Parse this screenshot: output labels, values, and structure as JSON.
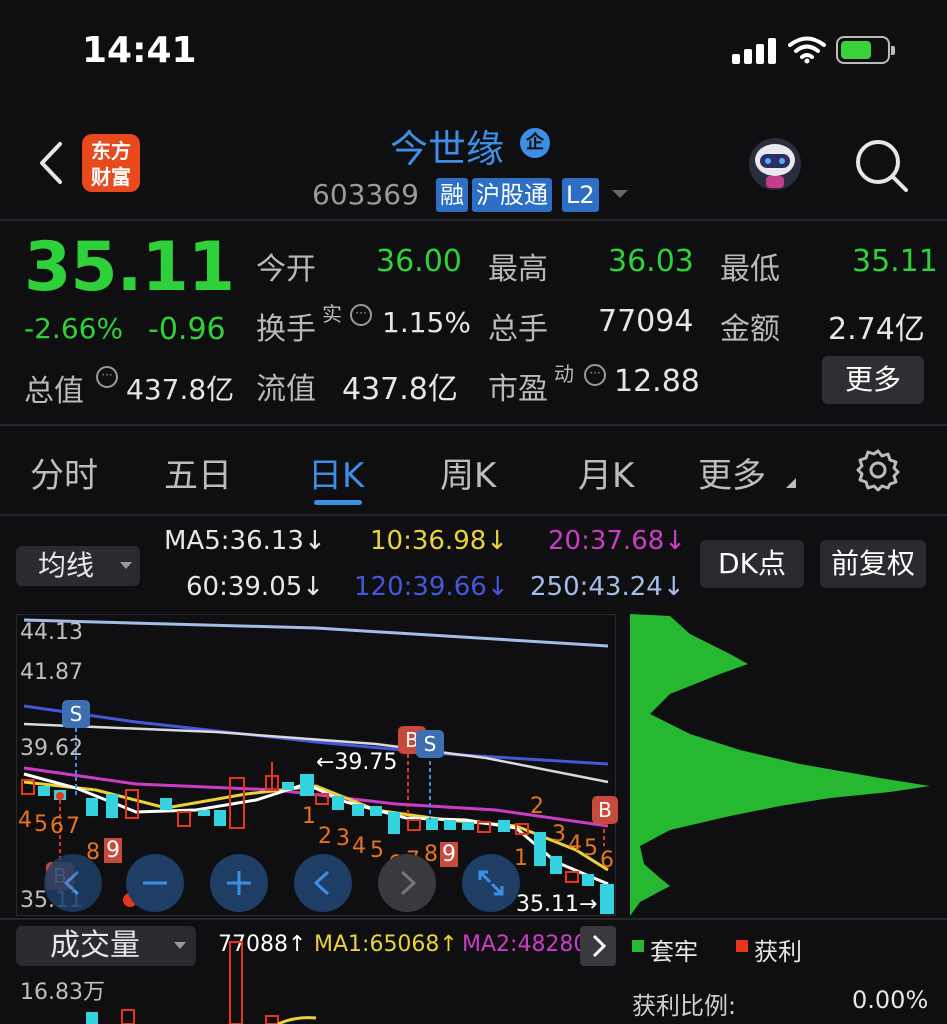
{
  "status_bar": {
    "time": "14:41"
  },
  "header": {
    "logo_line1": "东方",
    "logo_line2": "财富",
    "stock_name": "今世缘",
    "name_badge": "企",
    "stock_code": "603369",
    "tags": [
      "融",
      "沪股通",
      "L2"
    ]
  },
  "quote": {
    "price": "35.11",
    "change_pct": "-2.66%",
    "change_abs": "-0.96",
    "total_value_label": "总值",
    "total_value": "437.8亿",
    "fields": [
      {
        "label": "今开",
        "value": "36.00"
      },
      {
        "label": "最高",
        "value": "36.03"
      },
      {
        "label": "最低",
        "value": "35.11"
      },
      {
        "label": "换手",
        "sup": "实",
        "value": "1.15%"
      },
      {
        "label": "总手",
        "value": "77094"
      },
      {
        "label": "金额",
        "value": "2.74亿"
      },
      {
        "label": "流值",
        "value": "437.8亿"
      },
      {
        "label": "市盈",
        "sup": "动",
        "value": "12.88"
      }
    ],
    "more_button": "更多"
  },
  "tabs": [
    "分时",
    "五日",
    "日K",
    "周K",
    "月K",
    "更多"
  ],
  "active_tab": "日K",
  "ma_bar": {
    "selector": "均线",
    "ma5": "MA5:36.13↓",
    "ma10": "10:36.98↓",
    "ma20": "20:37.68↓",
    "ma60": "60:39.05↓",
    "ma120": "120:39.66↓",
    "ma250": "250:43.24↓",
    "dk_button": "DK点",
    "fq_button": "前复权"
  },
  "chart": {
    "y_labels": [
      "44.13",
      "41.87",
      "39.62",
      "35.11"
    ],
    "high_annotation": "←39.75",
    "low_annotation": "35.11→",
    "markers": [
      "S",
      "B",
      "S",
      "B",
      "B"
    ],
    "row1_numbers": [
      "4",
      "5",
      "6",
      "7"
    ],
    "row2_numbers": [
      "8",
      "9"
    ],
    "seq_numbers": [
      "1",
      "2",
      "3",
      "4",
      "5",
      "6",
      "7",
      "8",
      "9"
    ],
    "right_numbers": [
      "2",
      "1",
      "3",
      "4",
      "5",
      "6"
    ]
  },
  "volume": {
    "selector": "成交量",
    "vol": "77088↑",
    "ma1": "MA1:65068↑",
    "ma2": "MA2:48280",
    "y_label": "16.83万"
  },
  "distribution": {
    "legend_trapped": "套牢",
    "legend_profit": "获利",
    "profit_ratio_label": "获利比例:",
    "profit_ratio": "0.00%"
  },
  "colors": {
    "up_red": "#e8341d",
    "down_green": "#2fd13a",
    "accent_blue": "#3d8fe6",
    "candle_cyan": "#35d3e0"
  }
}
